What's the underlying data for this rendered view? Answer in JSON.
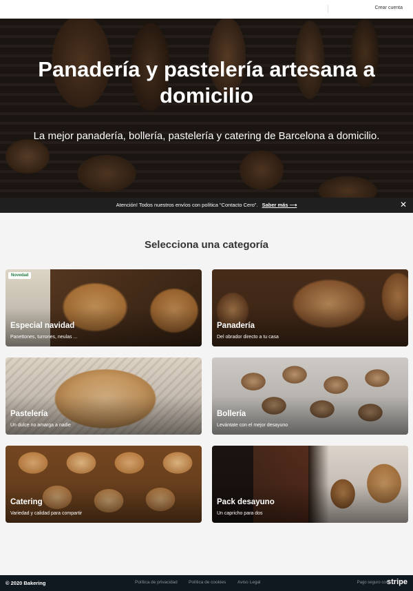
{
  "header": {
    "create_account": "Crear cuenta"
  },
  "hero": {
    "title": "Panadería y pastelería artesana a domicilio",
    "subtitle": "La mejor panadería, bollería, pastelería y catering de Barcelona a domicilio."
  },
  "notice": {
    "text": "Atención! Todos nuestros envíos con política “Contacto Cero”.",
    "link": "Saber más ⟶",
    "close": "✕"
  },
  "categories": {
    "title": "Selecciona una categoría",
    "items": [
      {
        "title": "Especial navidad",
        "subtitle": "Panettones, turrones, neulas ...",
        "badge": "Novedad"
      },
      {
        "title": "Panadería",
        "subtitle": "Del obrador directo a tu casa"
      },
      {
        "title": "Pastelería",
        "subtitle": "Un dulce no amarga a nadie"
      },
      {
        "title": "Bollería",
        "subtitle": "Levántate con el mejor desayuno"
      },
      {
        "title": "Catering",
        "subtitle": "Variedad y calidad para compartir"
      },
      {
        "title": "Pack desayuno",
        "subtitle": "Un capricho para dos"
      }
    ]
  },
  "footer": {
    "copyright": "© 2020 Bakering",
    "links": [
      "Política de privacidad",
      "Política de cookies",
      "Aviso Legal"
    ],
    "payment_text": "Pago seguro con",
    "payment_brand": "stripe"
  }
}
